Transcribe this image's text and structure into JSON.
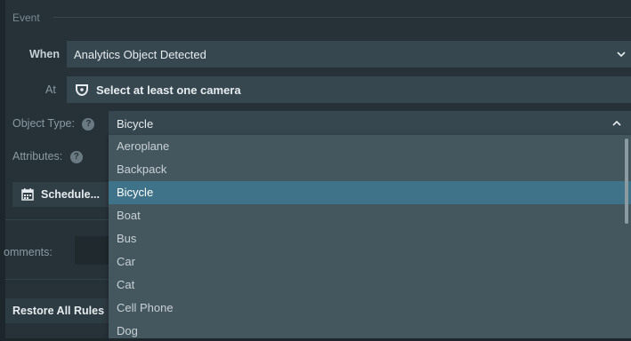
{
  "group": {
    "title": "Event"
  },
  "when": {
    "label": "When",
    "value": "Analytics Object Detected"
  },
  "at": {
    "label": "At",
    "value": "Select at least one camera"
  },
  "object_type": {
    "label": "Object Type:",
    "value": "Bicycle"
  },
  "attributes": {
    "label": "Attributes:"
  },
  "schedule": {
    "label": "Schedule..."
  },
  "comments": {
    "label": "omments:"
  },
  "restore": {
    "label": "Restore All Rules"
  },
  "options": [
    "Aeroplane",
    "Backpack",
    "Bicycle",
    "Boat",
    "Bus",
    "Car",
    "Cat",
    "Cell Phone",
    "Dog"
  ],
  "selected_option": "Bicycle",
  "icons": {
    "help": "?",
    "chevron_down": "⌄",
    "chevron_up": "^"
  },
  "colors": {
    "background": "#263238",
    "field": "#37474f",
    "dropdown": "#44565e",
    "selected": "#3f7389"
  }
}
